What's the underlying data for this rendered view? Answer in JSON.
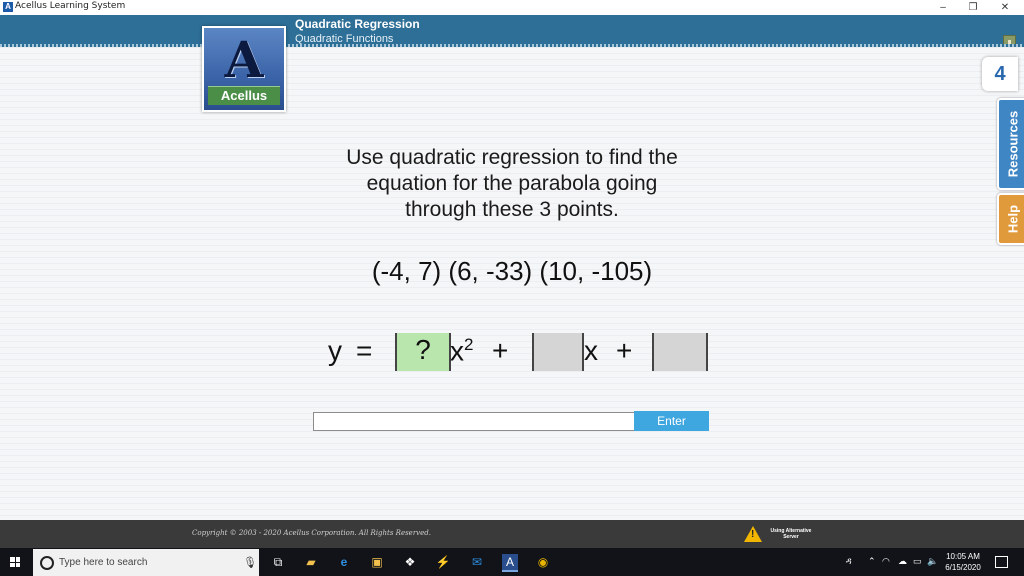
{
  "window": {
    "title": "Acellus Learning System",
    "controls": {
      "minimize": "–",
      "restore": "❐",
      "close": "✕"
    }
  },
  "header": {
    "course": "Quadratic Regression",
    "unit": "Quadratic Functions"
  },
  "logo": {
    "mark": "A",
    "brand": "Acellus"
  },
  "side": {
    "number": "4",
    "resources": "Resources",
    "help": "Help"
  },
  "question": {
    "prompt_line1": "Use quadratic regression to find the",
    "prompt_line2": "equation for the parabola going",
    "prompt_line3": "through these 3 points.",
    "points": "(-4, 7) (6, -33) (10, -105)"
  },
  "equation": {
    "y": "y",
    "equals": "=",
    "slot_a": "?",
    "x2_base": "x",
    "x2_exp": "2",
    "plus1": "+",
    "x_term": "x",
    "plus2": "+",
    "colors": {
      "active_slot": "#b8e6ad",
      "empty_slot": "#d5d5d5"
    }
  },
  "answer": {
    "value": "",
    "enter_label": "Enter",
    "enter_color": "#3fa7e0"
  },
  "footer": {
    "copyright": "Copyright © 2003 - 2020 Acellus Corporation.  All Rights Reserved.",
    "server_line1": "Using Alternative",
    "server_line2": "Server"
  },
  "taskbar": {
    "search_placeholder": "Type here to search",
    "time": "10:05 AM",
    "date": "6/15/2020",
    "icons": [
      "task-view-icon",
      "file-explorer-icon",
      "edge-icon",
      "store-icon",
      "dropbox-icon",
      "app-icon",
      "mail-icon",
      "acellus-icon",
      "chrome-icon"
    ]
  }
}
